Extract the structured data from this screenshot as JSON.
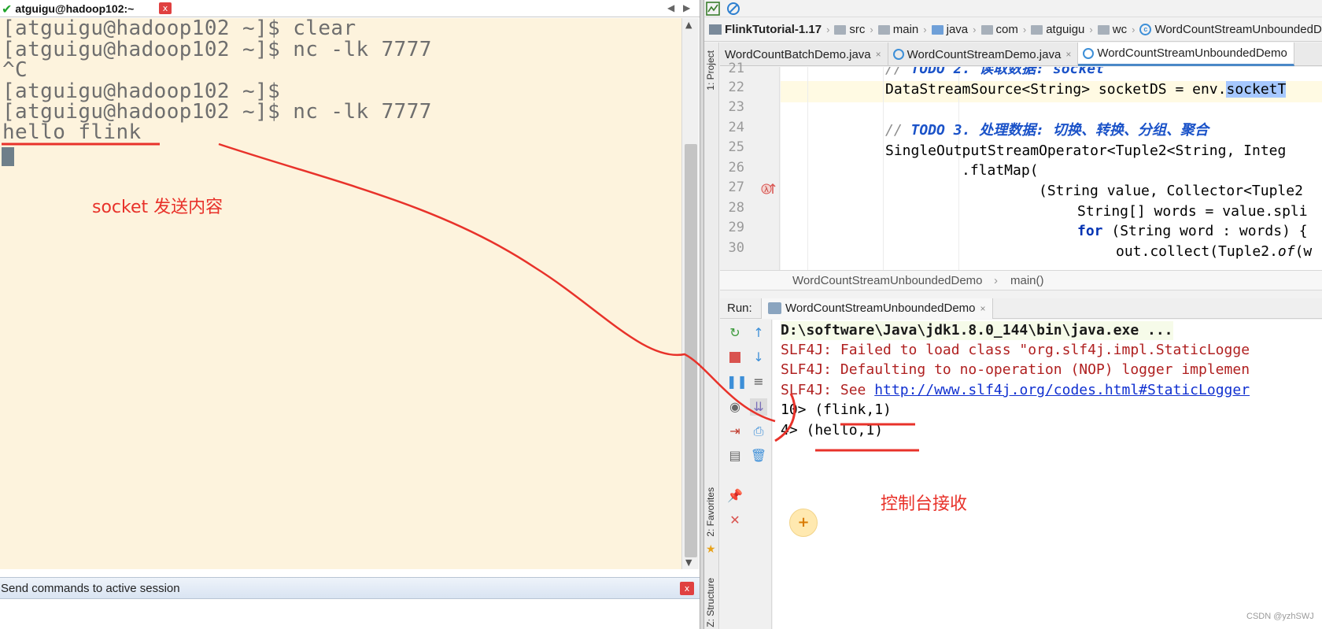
{
  "terminal": {
    "title": "atguigu@hadoop102:~",
    "close_glyph": "x",
    "prev_glyph": "◀",
    "next_glyph": "▶",
    "lines": [
      "[atguigu@hadoop102 ~]$ clear",
      "[atguigu@hadoop102 ~]$ nc -lk 7777",
      "^C",
      "[atguigu@hadoop102 ~]$",
      "[atguigu@hadoop102 ~]$ nc -lk 7777",
      "hello flink"
    ],
    "send_commands_label": "Send commands to active session",
    "send_close_glyph": "x"
  },
  "ide": {
    "breadcrumb": [
      "FlinkTutorial-1.17",
      "src",
      "main",
      "java",
      "com",
      "atguigu",
      "wc",
      "WordCountStreamUnboundedDemo"
    ],
    "side_labels": {
      "project": "1: Project",
      "favorites": "2: Favorites",
      "structure": "Z: Structure"
    },
    "tabs": [
      {
        "label": "WordCountBatchDemo.java",
        "close": "×"
      },
      {
        "label": "WordCountStreamDemo.java",
        "close": "×"
      },
      {
        "label": "WordCountStreamUnboundedDemo",
        "close": ""
      }
    ],
    "line_numbers": [
      "21",
      "22",
      "23",
      "24",
      "25",
      "26",
      "27",
      "28",
      "29",
      "30"
    ],
    "code": {
      "l21_comment": "// ",
      "l21_todo": "TODO 2. 读取数据: socket",
      "l22_pre": "DataStreamSource<String> socketDS = env.",
      "l22_sel": "socketT",
      "l24_comment": "// ",
      "l24_todo": "TODO 3. 处理数据: 切换、转换、分组、聚合",
      "l25": "SingleOutputStreamOperator<Tuple2<String, Integ",
      "l26": ".flatMap(",
      "l27": "(String value, Collector<Tuple2",
      "l28": "String[] words = value.spli",
      "l29_kw": "for",
      "l29_rest": " (String word : words) {",
      "l30_pre": "out.collect(Tuple2.",
      "l30_ital": "of",
      "l30_post": "(w"
    },
    "method_crumb": {
      "class": "WordCountStreamUnboundedDemo",
      "sep": "›",
      "method": "main()"
    },
    "run": {
      "label": "Run:",
      "tab": "WordCountStreamUnboundedDemo",
      "tab_close": "×",
      "console": {
        "path": "D:\\software\\Java\\jdk1.8.0_144\\bin\\java.exe ...",
        "err1": "SLF4J: Failed to load class \"org.slf4j.impl.StaticLogge",
        "err2": "SLF4J: Defaulting to no-operation (NOP) logger implemen",
        "err3_pre": "SLF4J: See ",
        "err3_link": "http://www.slf4j.org/codes.html#StaticLogger",
        "out1": "10> (flink,1)",
        "out2": "4> (hello,1)"
      }
    }
  },
  "annotations": {
    "socket_send": "socket 发送内容",
    "console_receive": "控制台接收",
    "color": "#e8322a"
  },
  "watermark": "CSDN @yzhSWJ"
}
